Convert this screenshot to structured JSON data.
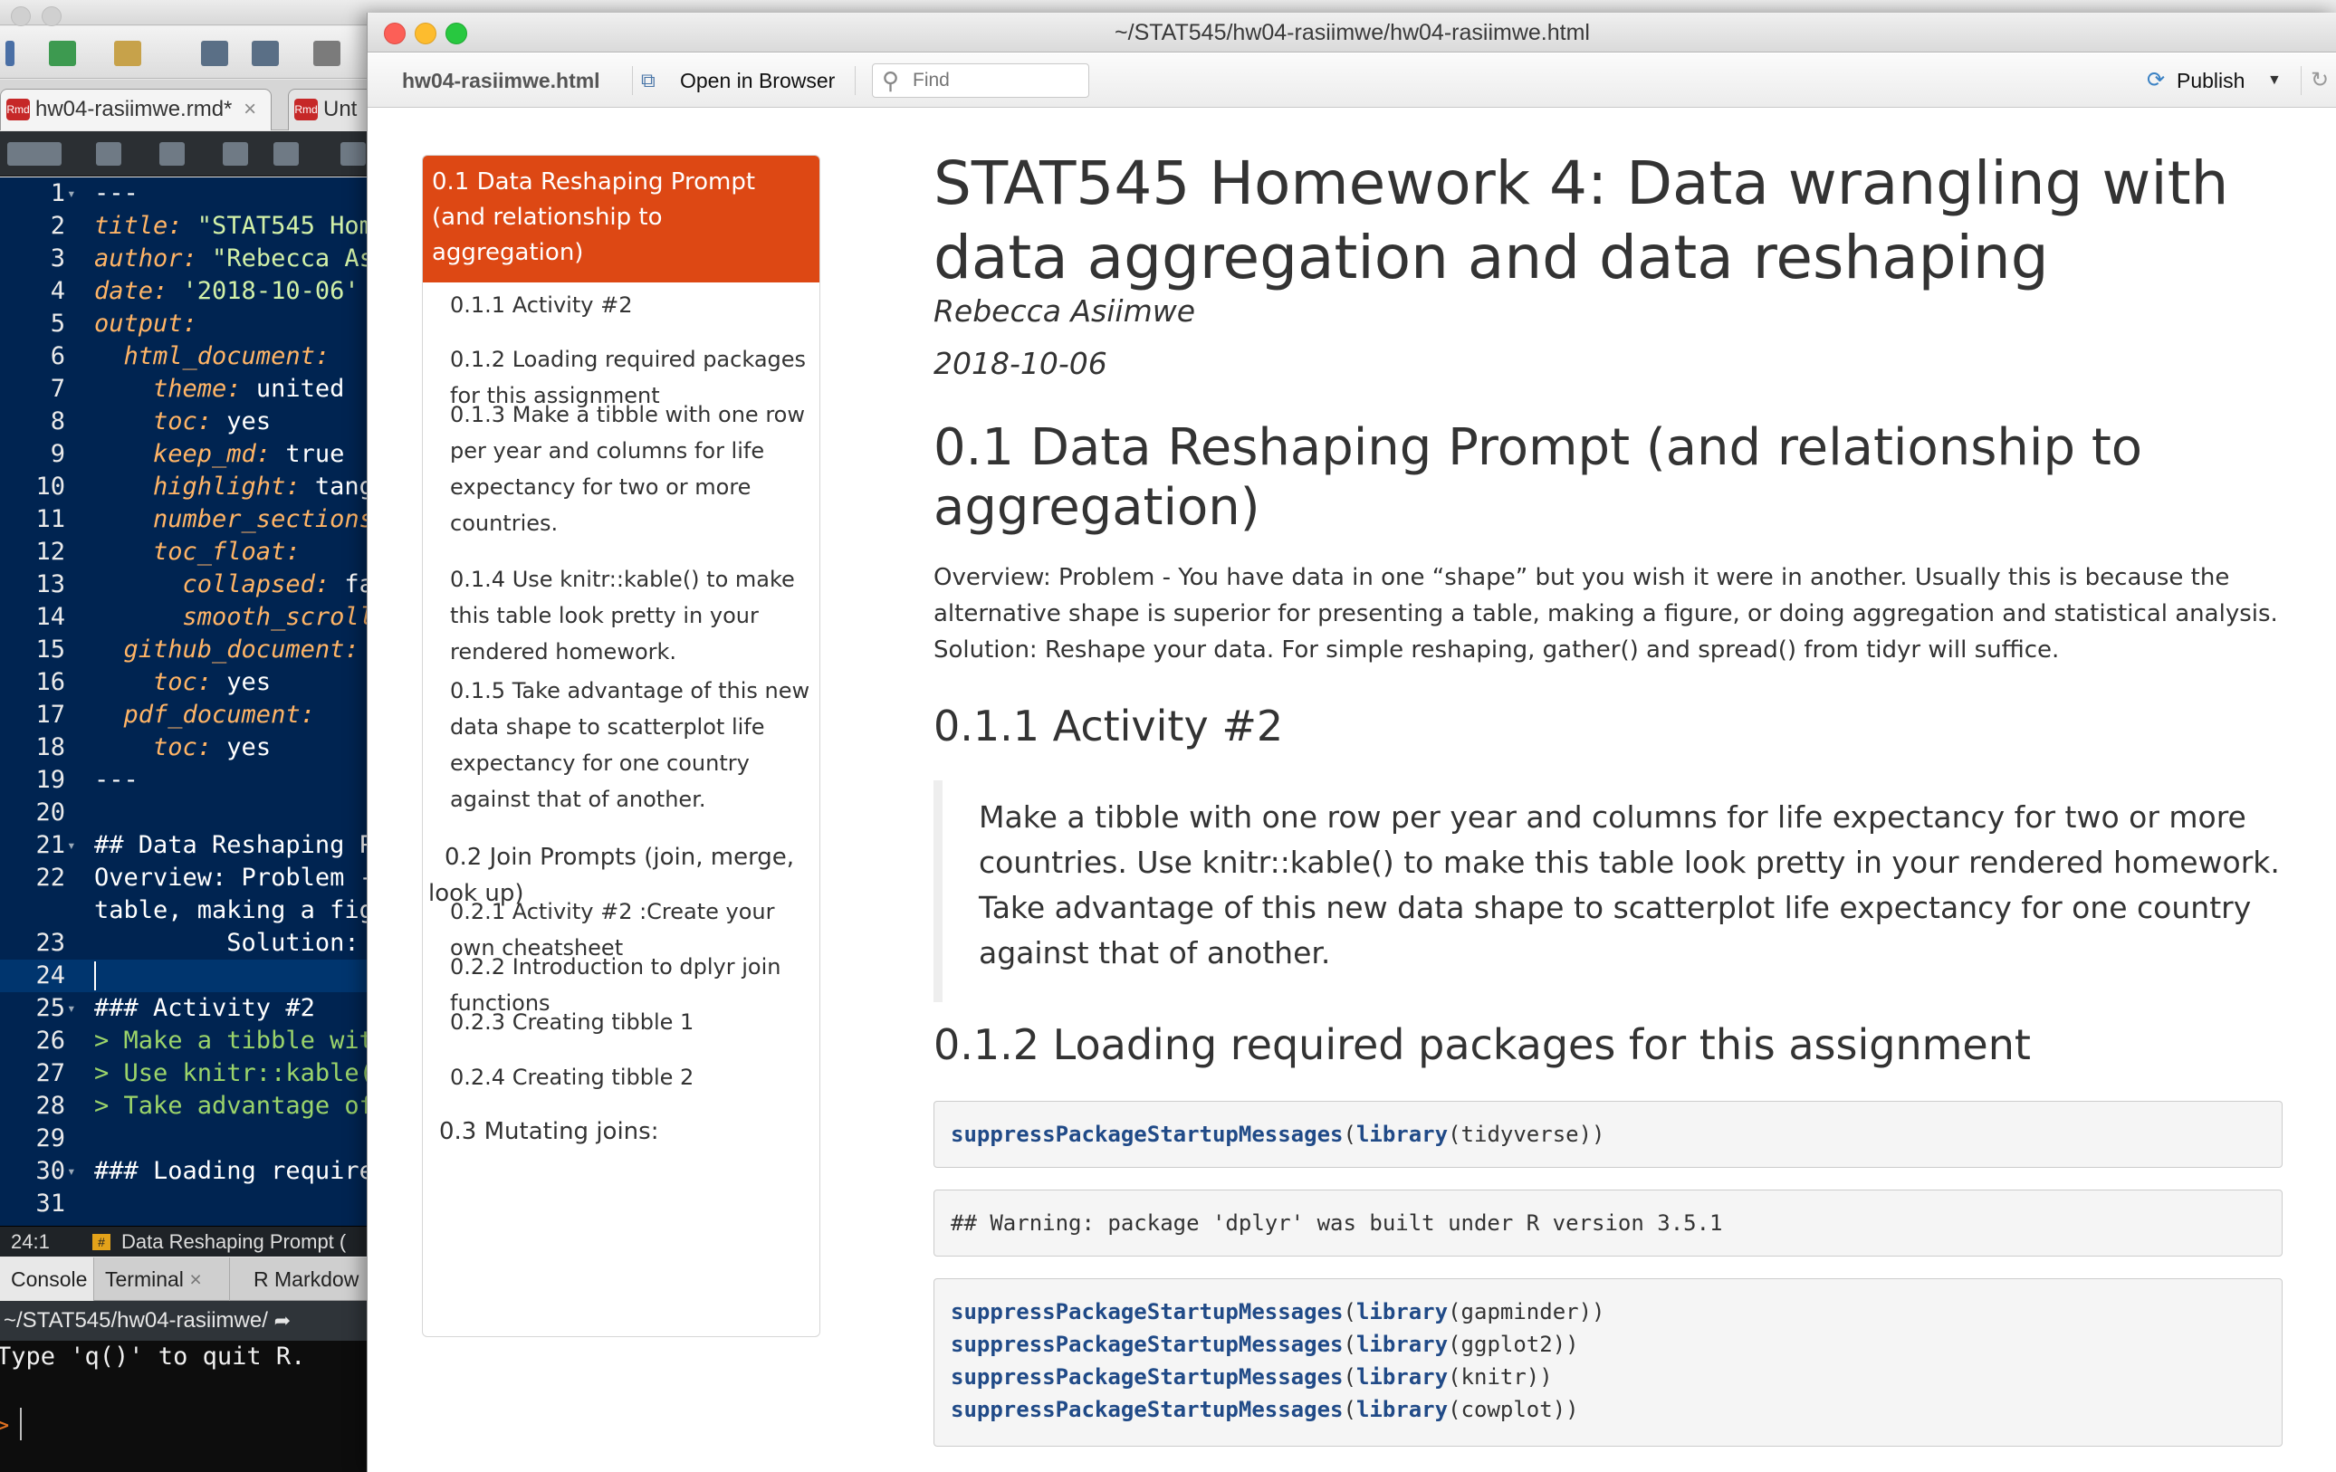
{
  "rstudio": {
    "editor_tabs": [
      {
        "label": "hw04-rasiimwe.rmd*",
        "close": "×"
      },
      {
        "label": "Unt"
      }
    ],
    "code_lines": [
      {
        "n": "1",
        "fold": "▾",
        "parts": [
          {
            "t": "---",
            "c": "w"
          }
        ]
      },
      {
        "n": "2",
        "parts": [
          {
            "t": "title:",
            "c": "k"
          },
          {
            "t": " \"STAT545 Home",
            "c": "s"
          }
        ]
      },
      {
        "n": "3",
        "parts": [
          {
            "t": "author:",
            "c": "k"
          },
          {
            "t": " \"Rebecca As",
            "c": "s"
          }
        ]
      },
      {
        "n": "4",
        "parts": [
          {
            "t": "date:",
            "c": "k"
          },
          {
            "t": " '2018-10-06'",
            "c": "s"
          }
        ]
      },
      {
        "n": "5",
        "parts": [
          {
            "t": "output:",
            "c": "k"
          }
        ]
      },
      {
        "n": "6",
        "parts": [
          {
            "t": "  html_document:",
            "c": "k"
          }
        ]
      },
      {
        "n": "7",
        "parts": [
          {
            "t": "    theme:",
            "c": "k"
          },
          {
            "t": " united",
            "c": "w"
          }
        ]
      },
      {
        "n": "8",
        "parts": [
          {
            "t": "    toc:",
            "c": "k"
          },
          {
            "t": " yes",
            "c": "w"
          }
        ]
      },
      {
        "n": "9",
        "parts": [
          {
            "t": "    keep_md:",
            "c": "k"
          },
          {
            "t": " true",
            "c": "w"
          }
        ]
      },
      {
        "n": "10",
        "parts": [
          {
            "t": "    highlight:",
            "c": "k"
          },
          {
            "t": " tang",
            "c": "w"
          }
        ]
      },
      {
        "n": "11",
        "parts": [
          {
            "t": "    number_sections",
            "c": "k"
          }
        ]
      },
      {
        "n": "12",
        "parts": [
          {
            "t": "    toc_float:",
            "c": "k"
          }
        ]
      },
      {
        "n": "13",
        "parts": [
          {
            "t": "      collapsed:",
            "c": "k"
          },
          {
            "t": " fa",
            "c": "w"
          }
        ]
      },
      {
        "n": "14",
        "parts": [
          {
            "t": "      smooth_scroll",
            "c": "k"
          }
        ]
      },
      {
        "n": "15",
        "parts": [
          {
            "t": "  github_document:",
            "c": "k"
          }
        ]
      },
      {
        "n": "16",
        "parts": [
          {
            "t": "    toc:",
            "c": "k"
          },
          {
            "t": " yes",
            "c": "w"
          }
        ]
      },
      {
        "n": "17",
        "parts": [
          {
            "t": "  pdf_document:",
            "c": "k"
          }
        ]
      },
      {
        "n": "18",
        "parts": [
          {
            "t": "    toc:",
            "c": "k"
          },
          {
            "t": " yes",
            "c": "w"
          }
        ]
      },
      {
        "n": "19",
        "parts": [
          {
            "t": "---",
            "c": "w"
          }
        ]
      },
      {
        "n": "20",
        "parts": []
      },
      {
        "n": "21",
        "fold": "▾",
        "parts": [
          {
            "t": "## Data Reshaping P",
            "c": "w"
          }
        ]
      },
      {
        "n": "22",
        "parts": [
          {
            "t": "Overview: Problem -",
            "c": "w"
          }
        ]
      },
      {
        "n": "",
        "parts": [
          {
            "t": "table, making a fig",
            "c": "w"
          }
        ]
      },
      {
        "n": "23",
        "parts": [
          {
            "t": "         Solution:",
            "c": "w"
          }
        ]
      },
      {
        "n": "24",
        "cur": true,
        "parts": []
      },
      {
        "n": "25",
        "fold": "▾",
        "parts": [
          {
            "t": "### Activity #2",
            "c": "w"
          }
        ]
      },
      {
        "n": "26",
        "parts": [
          {
            "t": "> Make a tibble wit",
            "c": "g"
          }
        ]
      },
      {
        "n": "27",
        "parts": [
          {
            "t": "> Use knitr::kable(",
            "c": "g"
          }
        ]
      },
      {
        "n": "28",
        "parts": [
          {
            "t": "> Take advantage of",
            "c": "g"
          }
        ]
      },
      {
        "n": "29",
        "parts": []
      },
      {
        "n": "30",
        "fold": "▾",
        "parts": [
          {
            "t": "### Loading require",
            "c": "w"
          }
        ]
      },
      {
        "n": "31",
        "parts": []
      }
    ],
    "status_position": "24:1",
    "status_section": "Data Reshaping Prompt (",
    "status_badge": "#",
    "console_tabs": [
      {
        "label": "Console"
      },
      {
        "label": "Terminal",
        "close": "×"
      },
      {
        "label": "R Markdow"
      }
    ],
    "console_path": "~/STAT545/hw04-rasiimwe/",
    "console_line": "Type 'q()' to quit R.",
    "console_prompt": ">"
  },
  "viewer": {
    "title": "~/STAT545/hw04-rasiimwe/hw04-rasiimwe.html",
    "file_label": "hw04-rasiimwe.html",
    "open_browser_label": "Open in Browser",
    "find_placeholder": "Find",
    "publish_label": "Publish"
  },
  "toc": {
    "active": "0.1 Data Reshaping Prompt (and relationship to aggregation)",
    "items": [
      {
        "text": "0.1.1 Activity #2",
        "level": 3
      },
      {
        "text": "0.1.2 Loading required packages for this assignment",
        "level": 3
      },
      {
        "text": "0.1.3 Make a tibble with one row per year and columns for life expectancy for two or more countries.",
        "level": 3
      },
      {
        "text": "0.1.4 Use knitr::kable() to make this table look pretty in your rendered homework.",
        "level": 3
      },
      {
        "text": "0.1.5 Take advantage of this new data shape to scatterplot life expectancy for one country against that of another.",
        "level": 3
      },
      {
        "text": "0.2 Join Prompts (join, merge, look up)",
        "level": 2
      },
      {
        "text": "0.2.1 Activity #2 :Create your own cheatsheet",
        "level": 3
      },
      {
        "text": "0.2.2 Introduction to dplyr join functions",
        "level": 3
      },
      {
        "text": "0.2.3 Creating tibble 1",
        "level": 3
      },
      {
        "text": "0.2.4 Creating tibble 2",
        "level": 3
      },
      {
        "text": "0.3 Mutating joins:",
        "level": 2
      }
    ]
  },
  "doc": {
    "title": "STAT545 Homework 4: Data wrangling with data aggregation and data reshaping",
    "author": "Rebecca Asiimwe",
    "date": "2018-10-06",
    "section_heading": "0.1 Data Reshaping Prompt (and relationship to aggregation)",
    "overview": "Overview: Problem - You have data in one “shape” but you wish it were in another. Usually this is because the alternative shape is superior for presenting a table, making a figure, or doing aggregation and statistical analysis. Solution: Reshape your data. For simple reshaping, gather() and spread() from tidyr will suffice.",
    "activity_heading": "0.1.1 Activity #2",
    "blockquote": "Make a tibble with one row per year and columns for life expectancy for two or more countries. Use knitr::kable() to make this table look pretty in your rendered homework. Take advantage of this new data shape to scatterplot life expectancy for one country against that of another.",
    "loading_heading": "0.1.2 Loading required packages for this assignment",
    "code1": {
      "fn": "suppressPackageStartupMessages",
      "lib": "library",
      "arg": "tidyverse"
    },
    "warning": "## Warning: package 'dplyr' was built under R version 3.5.1",
    "code2": [
      {
        "fn": "suppressPackageStartupMessages",
        "lib": "library",
        "arg": "gapminder"
      },
      {
        "fn": "suppressPackageStartupMessages",
        "lib": "library",
        "arg": "ggplot2"
      },
      {
        "fn": "suppressPackageStartupMessages",
        "lib": "library",
        "arg": "knitr"
      },
      {
        "fn": "suppressPackageStartupMessages",
        "lib": "library",
        "arg": "cowplot"
      }
    ]
  },
  "colors": {
    "accent": "#dd4814",
    "editor_bg": "#002451",
    "code_fn": "#204a87"
  }
}
